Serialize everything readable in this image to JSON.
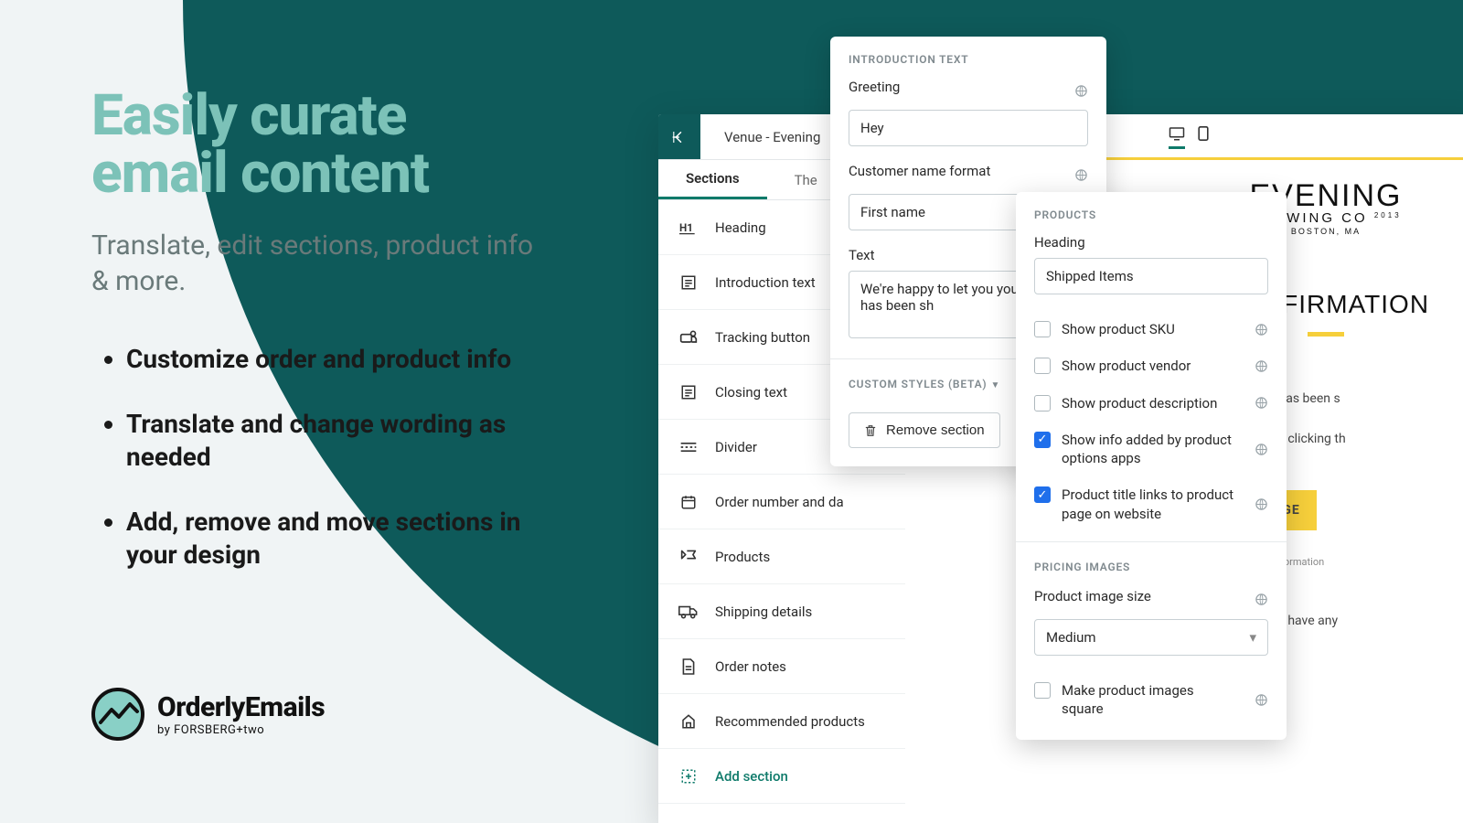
{
  "marketing": {
    "headline": "Easily curate email content",
    "subhead": "Translate, edit sections, product info & more.",
    "bullets": [
      "Customize order and product info",
      "Translate and change wording as needed",
      "Add, remove and move sections in your design"
    ],
    "brand_name": "OrderlyEmails",
    "brand_byline": "by FORSBERG+two"
  },
  "editor": {
    "venue_label": "Venue - Evening",
    "tabs": {
      "sections": "Sections",
      "theme": "The"
    },
    "sections": [
      {
        "icon": "h1",
        "label": "Heading"
      },
      {
        "icon": "text",
        "label": "Introduction text"
      },
      {
        "icon": "tracking",
        "label": "Tracking button"
      },
      {
        "icon": "text",
        "label": "Closing text"
      },
      {
        "icon": "divider",
        "label": "Divider"
      },
      {
        "icon": "order",
        "label": "Order number and da",
        "drag": true
      },
      {
        "icon": "products",
        "label": "Products",
        "drag": true
      },
      {
        "icon": "shipping",
        "label": "Shipping details",
        "drag": true
      },
      {
        "icon": "notes",
        "label": "Order notes",
        "drag": true
      },
      {
        "icon": "recommended",
        "label": "Recommended products",
        "drag": true
      }
    ],
    "add_section": "Add section"
  },
  "intro_panel": {
    "title": "INTRODUCTION TEXT",
    "greeting_label": "Greeting",
    "greeting_value": "Hey",
    "name_format_label": "Customer name format",
    "name_format_value": "First name",
    "text_label": "Text",
    "text_value": "We're happy to let you your order has been sh",
    "custom_styles": "CUSTOM STYLES (BETA)",
    "remove": "Remove section"
  },
  "products_panel": {
    "title": "PRODUCTS",
    "heading_label": "Heading",
    "heading_value": "Shipped Items",
    "checks": [
      {
        "label": "Show product SKU",
        "on": false
      },
      {
        "label": "Show product vendor",
        "on": false
      },
      {
        "label": "Show product description",
        "on": false
      },
      {
        "label": "Show info added by product options apps",
        "on": true
      },
      {
        "label": "Product title links to product page on website",
        "on": true
      }
    ],
    "pricing_title": "PRICING IMAGES",
    "image_size_label": "Product image size",
    "image_size_value": "Medium",
    "square_label": "Make product images square"
  },
  "preview": {
    "brand_top": "EVENING",
    "brand_sub": "BREWING CO",
    "brand_city": "BOSTON, MA",
    "brand_year": "2013",
    "title": "CONFIRMATION",
    "p1": "w that your order has been s",
    "p2": "f your shipment by clicking th",
    "track": "RACK PACKAGE",
    "note": "time for the tracking information",
    "p3": "ontact us on if you have any"
  }
}
